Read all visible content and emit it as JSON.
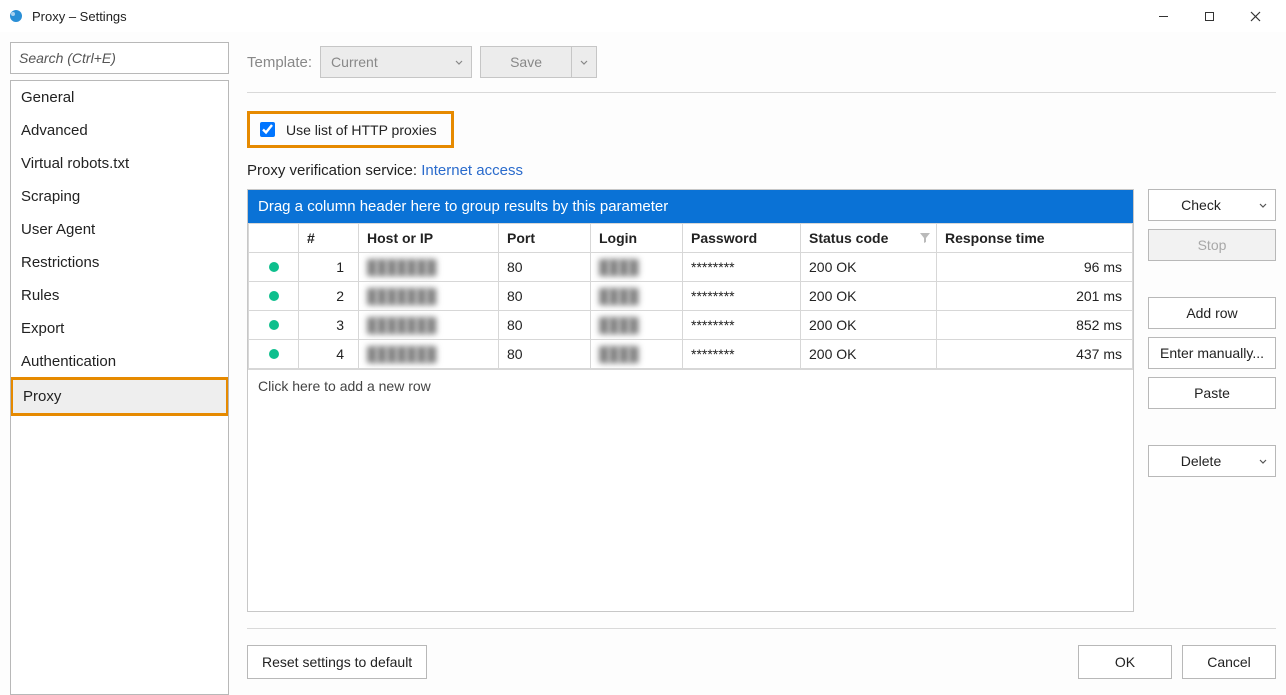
{
  "window": {
    "title": "Proxy – Settings"
  },
  "win_controls": {
    "min": "–",
    "max": "▢",
    "close": "✕"
  },
  "sidebar": {
    "search_placeholder": "Search (Ctrl+E)",
    "items": [
      "General",
      "Advanced",
      "Virtual robots.txt",
      "Scraping",
      "User Agent",
      "Restrictions",
      "Rules",
      "Export",
      "Authentication",
      "Proxy"
    ],
    "selected_index": 9
  },
  "template": {
    "label": "Template:",
    "value": "Current",
    "save_label": "Save"
  },
  "checkbox": {
    "label": "Use list of HTTP proxies",
    "checked": true
  },
  "verify": {
    "label": "Proxy verification service: ",
    "link": "Internet access"
  },
  "grid": {
    "group_hint": "Drag a column header here to group results by this parameter",
    "columns": {
      "num": "#",
      "host": "Host or IP",
      "port": "Port",
      "login": "Login",
      "password": "Password",
      "status": "Status code",
      "resp": "Response time"
    },
    "rows": [
      {
        "n": "1",
        "host": "███████",
        "port": "80",
        "login": "████",
        "password": "********",
        "status": "200 OK",
        "resp": "96 ms"
      },
      {
        "n": "2",
        "host": "███████",
        "port": "80",
        "login": "████",
        "password": "********",
        "status": "200 OK",
        "resp": "201 ms"
      },
      {
        "n": "3",
        "host": "███████",
        "port": "80",
        "login": "████",
        "password": "********",
        "status": "200 OK",
        "resp": "852 ms"
      },
      {
        "n": "4",
        "host": "███████",
        "port": "80",
        "login": "████",
        "password": "********",
        "status": "200 OK",
        "resp": "437 ms"
      }
    ],
    "add_hint": "Click here to add a new row"
  },
  "buttons": {
    "check": "Check",
    "stop": "Stop",
    "add_row": "Add row",
    "enter_manually": "Enter manually...",
    "paste": "Paste",
    "delete": "Delete"
  },
  "footer": {
    "reset": "Reset settings to default",
    "ok": "OK",
    "cancel": "Cancel"
  }
}
